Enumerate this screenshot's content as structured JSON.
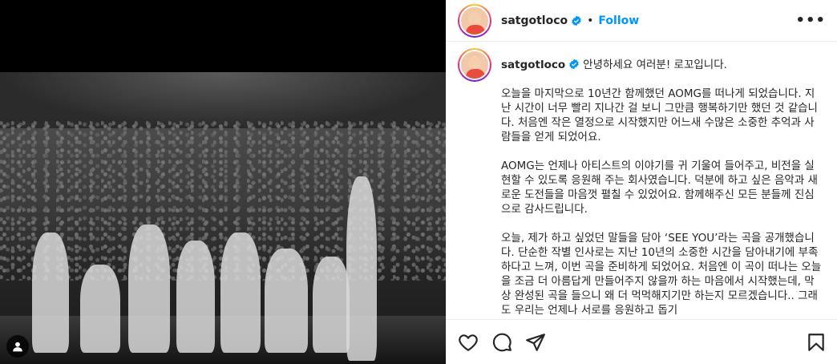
{
  "post": {
    "username": "satgotloco",
    "follow_label": "Follow",
    "separator": "•",
    "more_label": "•••"
  },
  "caption": {
    "username": "satgotloco",
    "greeting": "안녕하세요 여러분! 로꼬입니다.",
    "paragraphs": [
      "오늘을 마지막으로 10년간 함께했던 AOMG를 떠나게 되었습니다. 지난 시간이 너무 빨리 지나간 걸 보니 그만큼 행복하기만 했던 것 같습니다. 처음엔 작은 열정으로 시작했지만 어느새 수많은 소중한 추억과 사람들을 얻게 되었어요.",
      "AOMG는 언제나 아티스트의 이야기를 귀 기울여 들어주고, 비전을 실현할 수 있도록 응원해 주는 회사였습니다. 덕분에 하고 싶은 음악과 새로운 도전들을 마음껏 펼칠 수 있었어요. 함께해주신 모든 분들께 진심으로 감사드립니다.",
      "오늘, 제가 하고 싶었던 말들을 담아 ‘SEE YOU’라는 곡을 공개했습니다. 단순한 작별 인사로는 지난 10년의 소중한 시간을 담아내기에 부족하다고 느껴, 이번 곡을 준비하게 되었어요. 처음엔 이 곡이 떠나는 오늘을 조금 더 아름답게 만들어주지 않을까 하는 마음에서 시작했는데, 막상 완성된 곡을 들으니 왜 더 먹먹해지기만 하는지 모르겠습니다.. 그래도 우리는 언제나 서로를 응원하고 돕기"
    ]
  },
  "icons": {
    "verified": "verified-badge-icon",
    "like": "heart-icon",
    "comment": "comment-icon",
    "share": "send-icon",
    "save": "bookmark-icon",
    "tags": "user-tag-icon"
  },
  "colors": {
    "accent": "#0095f6",
    "verified": "#0095f6",
    "text": "#262626",
    "border": "#efefef"
  }
}
